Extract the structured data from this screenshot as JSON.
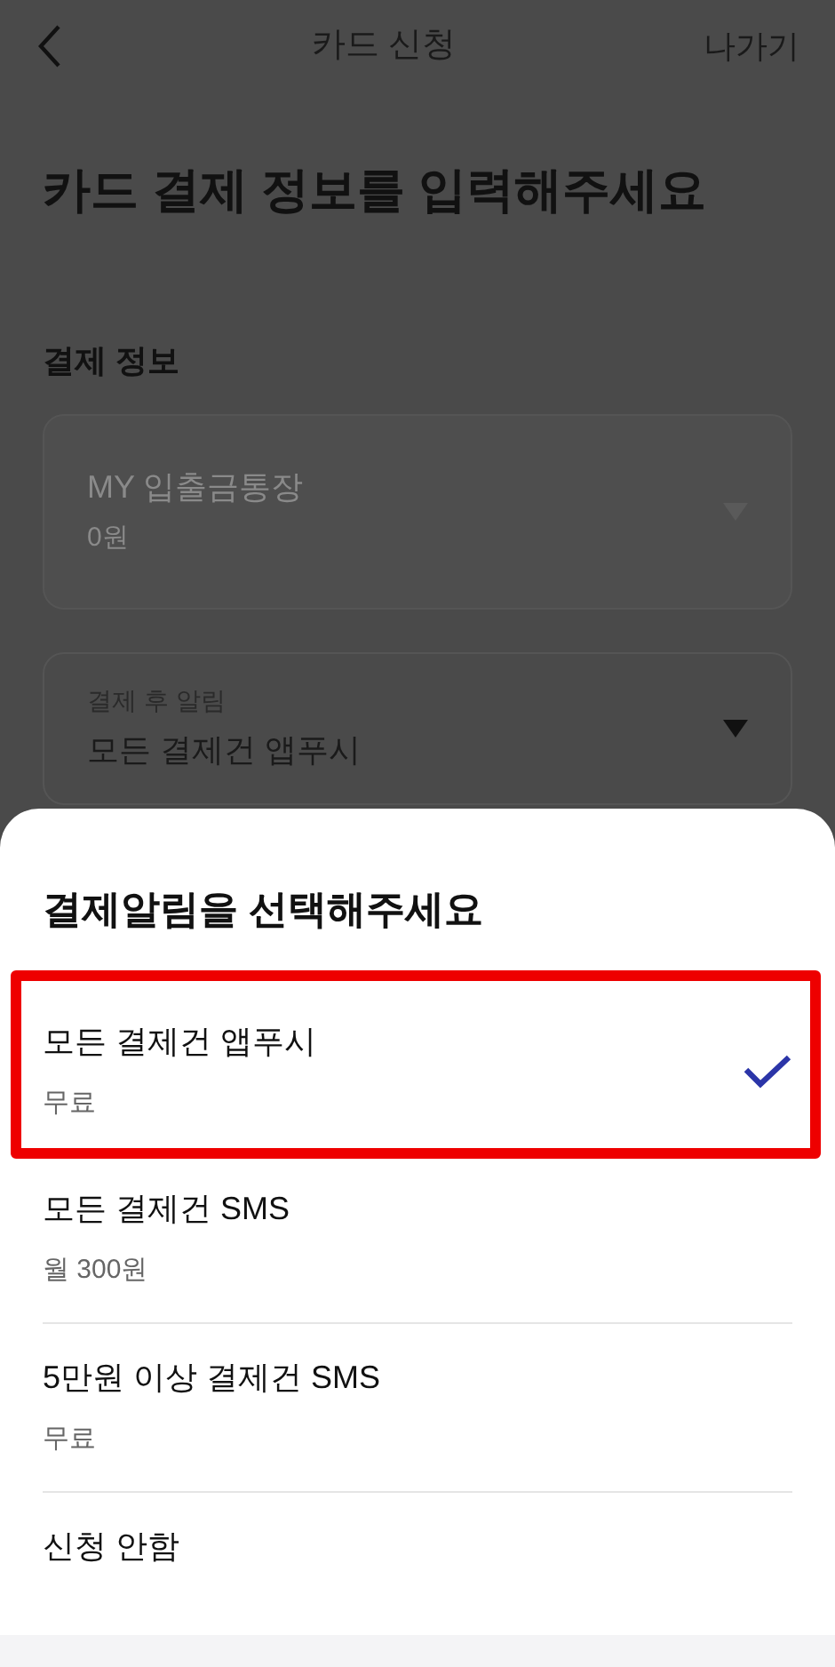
{
  "header": {
    "title": "카드 신청",
    "exit": "나가기"
  },
  "heading": "카드 결제 정보를 입력해주세요",
  "section_title": "결제 정보",
  "fields": [
    {
      "value": "MY 입출금통장",
      "sub": "0원",
      "disabled": true
    },
    {
      "label": "결제 후 알림",
      "value": "모든 결제건 앱푸시",
      "disabled": false
    }
  ],
  "sheet": {
    "title": "결제알림을 선택해주세요",
    "highlighted": true,
    "options": [
      {
        "label": "모든 결제건 앱푸시",
        "price": "무료",
        "selected": true
      },
      {
        "label": "모든 결제건 SMS",
        "price": "월 300원",
        "selected": false
      },
      {
        "label": "5만원 이상 결제건 SMS",
        "price": "무료",
        "selected": false
      },
      {
        "label": "신청 안함",
        "selected": false
      }
    ]
  }
}
